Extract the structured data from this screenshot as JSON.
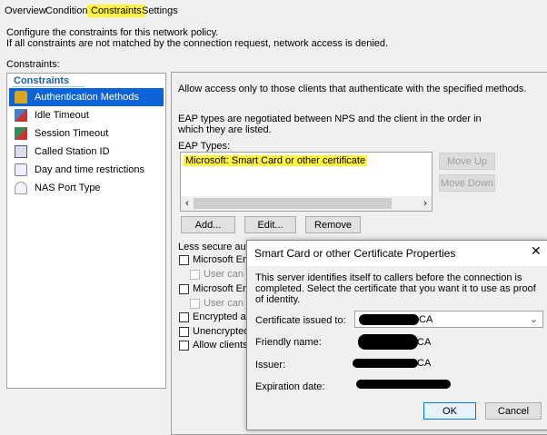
{
  "tabs": [
    "Overview",
    "Conditions",
    "Constraints",
    "Settings"
  ],
  "description": [
    "Configure the constraints for this network policy.",
    "If all constraints are not matched by the connection request, network access is denied."
  ],
  "constraints_label": "Constraints:",
  "sidebar": {
    "header": "Constraints",
    "items": [
      {
        "label": "Authentication Methods",
        "icon": "lock-icon",
        "selected": true
      },
      {
        "label": "Idle Timeout",
        "icon": "idle-timeout-icon"
      },
      {
        "label": "Session Timeout",
        "icon": "session-timeout-icon"
      },
      {
        "label": "Called Station ID",
        "icon": "station-id-icon"
      },
      {
        "label": "Day and time restrictions",
        "icon": "calendar-clock-icon"
      },
      {
        "label": "NAS Port Type",
        "icon": "antenna-icon"
      }
    ]
  },
  "main": {
    "intro": "Allow access only to those clients that authenticate with the specified methods.",
    "eap_note": "EAP types are negotiated between NPS and the client in the order in which they are listed.",
    "eap_label": "EAP Types:",
    "eap_items": [
      "Microsoft: Smart Card or other certificate"
    ],
    "move_up": "Move Up",
    "move_down": "Move Down",
    "add": "Add...",
    "edit": "Edit...",
    "remove": "Remove",
    "less_secure": "Less secure auther",
    "checkboxes": [
      "Microsoft Encry",
      "User can ch",
      "Microsoft Encry",
      "User can ch",
      "Encrypted auth",
      "Unencrypted au",
      "Allow clients to"
    ]
  },
  "dialog": {
    "title": "Smart Card or other Certificate Properties",
    "close": "✕",
    "text": "This server identifies itself to callers before the connection is completed. Select the certificate that you want it to use as proof of identity.",
    "fields": [
      {
        "label": "Certificate issued to:",
        "value_visible": "CA"
      },
      {
        "label": "Friendly name:",
        "value_visible": "CA"
      },
      {
        "label": "Issuer:",
        "value_visible": "CA"
      },
      {
        "label": "Expiration date:",
        "value_visible": ""
      }
    ],
    "ok": "OK",
    "cancel": "Cancel"
  }
}
